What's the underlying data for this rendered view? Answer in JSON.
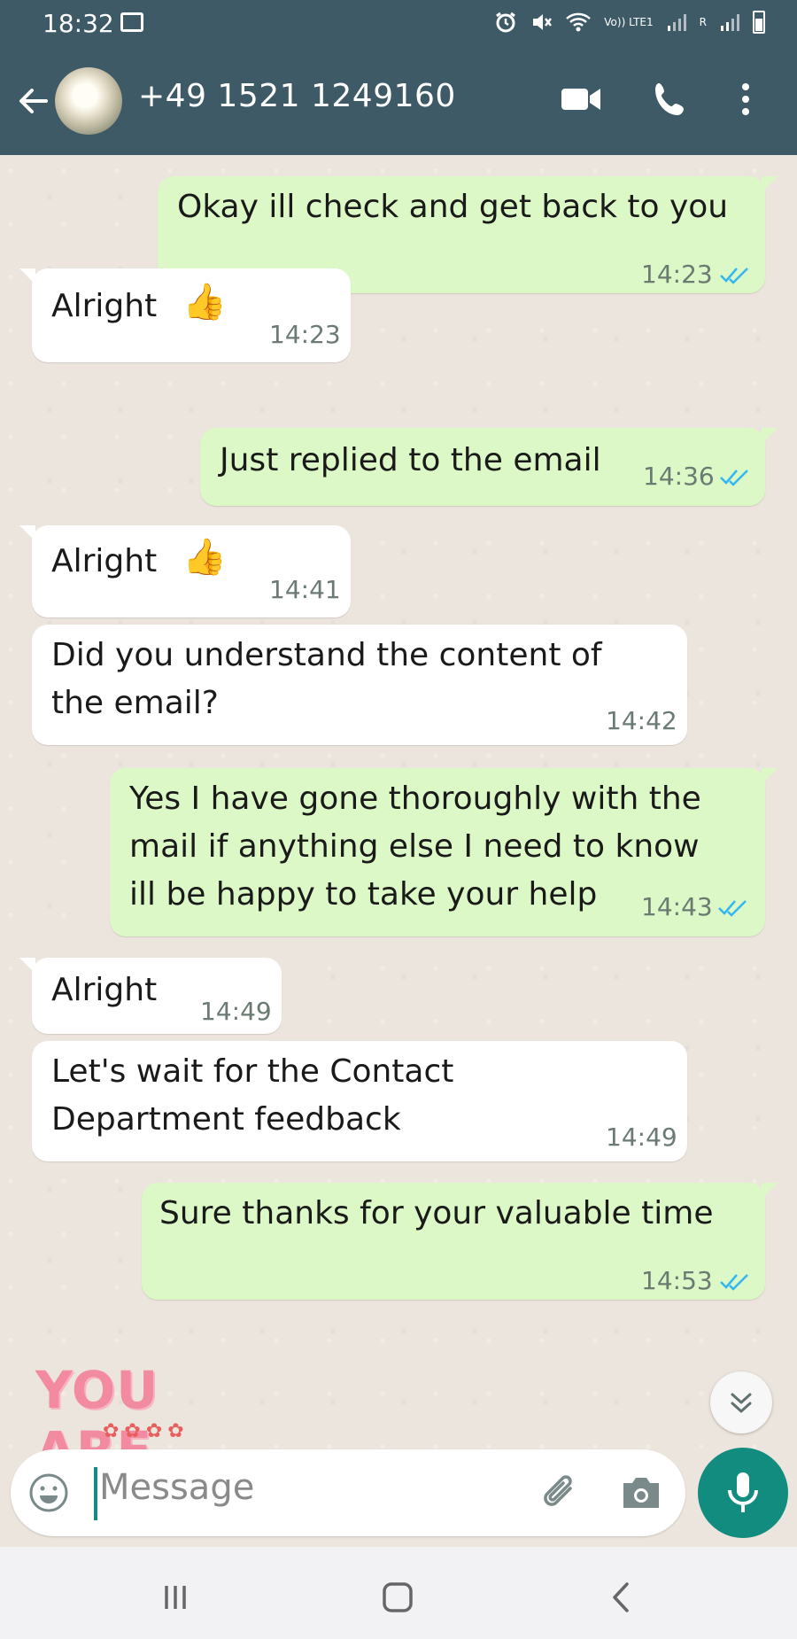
{
  "status_bar": {
    "time": "18:32",
    "network_label": "Vo)) LTE1",
    "sim_label": "R"
  },
  "header": {
    "contact": "+49 1521 1249160"
  },
  "messages": [
    {
      "dir": "out",
      "text": "Okay ill check and get back to you",
      "time": "14:23",
      "read": true
    },
    {
      "dir": "in",
      "text": "Alright",
      "emoji": "👍",
      "time": "14:23"
    },
    {
      "dir": "out",
      "text": "Just replied to the email",
      "time": "14:36",
      "read": true
    },
    {
      "dir": "in",
      "text": "Alright",
      "emoji": "👍",
      "time": "14:41"
    },
    {
      "dir": "in",
      "text": "Did you understand the content of\nthe email?",
      "time": "14:42"
    },
    {
      "dir": "out",
      "text": "Yes I have gone thoroughly with the\nmail if anything else I need to know\nill be happy to take your help",
      "time": "14:43",
      "read": true
    },
    {
      "dir": "in",
      "text": "Alright",
      "time": "14:49"
    },
    {
      "dir": "in",
      "text": "Let's wait for the Contact\nDepartment feedback",
      "time": "14:49"
    },
    {
      "dir": "out",
      "text": "Sure thanks for your valuable time",
      "time": "14:53",
      "read": true
    }
  ],
  "sticker": {
    "text": "YOU ARE"
  },
  "input": {
    "placeholder": "Message"
  },
  "colors": {
    "header_bg": "#3d5a66",
    "outgoing_bubble": "#dcf8c6",
    "incoming_bubble": "#ffffff",
    "chat_bg": "#ece5dd",
    "accent": "#128c7e",
    "read_ticks": "#34b7f1"
  },
  "icons": {
    "back": "arrow-left-icon",
    "video": "video-camera-icon",
    "call": "phone-icon",
    "more": "more-vertical-icon",
    "emoji": "smiley-icon",
    "attach": "paperclip-icon",
    "camera": "camera-icon",
    "mic": "microphone-icon",
    "scroll": "double-chevron-down-icon"
  }
}
